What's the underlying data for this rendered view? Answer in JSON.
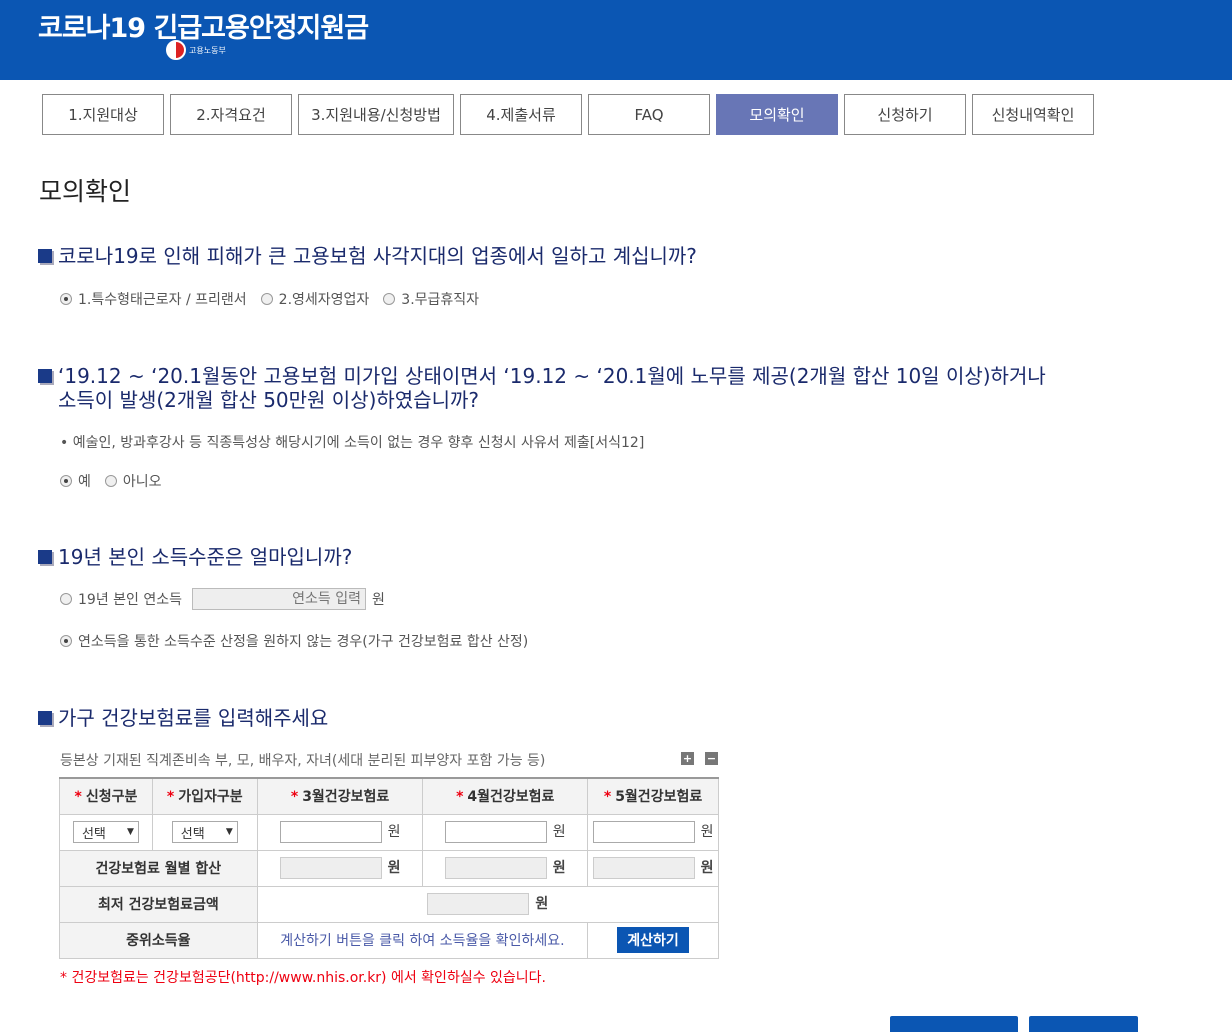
{
  "header": {
    "title": "코로나19 긴급고용안정지원금",
    "ministry": "고용노동부"
  },
  "tabs": [
    {
      "label": "1.지원대상"
    },
    {
      "label": "2.자격요건"
    },
    {
      "label": "3.지원내용/신청방법"
    },
    {
      "label": "4.제출서류"
    },
    {
      "label": "FAQ"
    },
    {
      "label": "모의확인",
      "active": true
    },
    {
      "label": "신청하기"
    },
    {
      "label": "신청내역확인"
    }
  ],
  "page_title": "모의확인",
  "q1": {
    "title": "코로나19로 인해 피해가 큰 고용보험 사각지대의 업종에서 일하고 계십니까?",
    "options": [
      "1.특수형태근로자 / 프리랜서",
      "2.영세자영업자",
      "3.무급휴직자"
    ],
    "selected": 0
  },
  "q2": {
    "title_line1": "‘19.12 ~ ‘20.1월동안 고용보험 미가입 상태이면서 ‘19.12 ~ ‘20.1월에 노무를 제공(2개월 합산 10일 이상)하거나",
    "title_line2": "소득이 발생(2개월 합산 50만원 이상)하였습니까?",
    "note": "예술인, 방과후강사 등 직종특성상 해당시기에 소득이 없는 경우 향후 신청시 사유서 제출[서식12]",
    "options": [
      "예",
      "아니오"
    ],
    "selected": 0
  },
  "q3": {
    "title": "19년 본인 소득수준은 얼마입니까?",
    "option1_label": "19년 본인 연소득",
    "income_placeholder": "연소득 입력",
    "unit": "원",
    "option2_label": "연소득을 통한 소득수준 산정을 원하지 않는 경우(가구 건강보험료 합산 산정)",
    "selected": 1
  },
  "q4": {
    "title": "가구 건강보험료를 입력해주세요",
    "caption": "등본상 기재된 직계존비속 부, 모, 배우자, 자녀(세대 분리된 피부양자 포함 가능 등)",
    "plus": "+",
    "minus": "−",
    "headers": [
      "신청구분",
      "가입자구분",
      "3월건강보험료",
      "4월건강보험료",
      "5월건강보험료"
    ],
    "select1": "선택",
    "select2": "선택",
    "unit": "원",
    "sum_label": "건강보험료 월별 합산",
    "min_label": "최저 건강보험료금액",
    "median_label": "중위소득율",
    "calc_msg": "계산하기 버튼을 클릭 하여 소득율을 확인하세요.",
    "calc_button": "계산하기"
  },
  "footnote": "* 건강보험료는 건강보험공단(http://www.nhis.or.kr) 에서 확인하실수 있습니다.",
  "colors": {
    "header_bg": "#0b56b3",
    "active_tab": "#6876b6",
    "question_text": "#1a2a6c",
    "required": "#ee0011"
  }
}
